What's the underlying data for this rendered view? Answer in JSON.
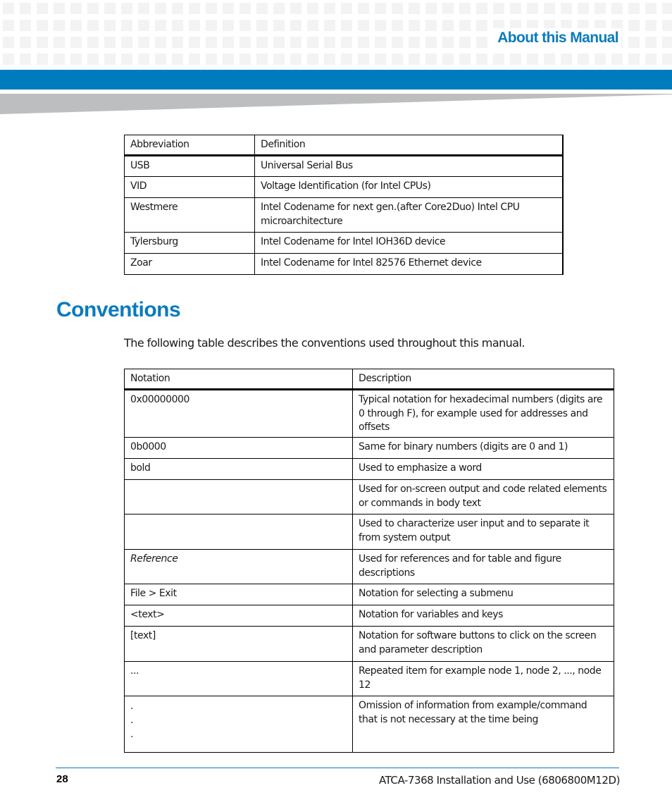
{
  "header": {
    "title": "About this Manual",
    "colors": {
      "accent_blue": "#007bbd",
      "title_blue": "#0a7bbd",
      "wedge_gray": "#bdbec0",
      "grid_gray": "#f3f3f3"
    }
  },
  "abbreviations_table": {
    "columns": [
      "Abbreviation",
      "Definition"
    ],
    "rows": [
      [
        "USB",
        "Universal Serial Bus"
      ],
      [
        "VID",
        "Voltage Identification (for Intel CPUs)"
      ],
      [
        "Westmere",
        "Intel Codename for next gen.(after Core2Duo) Intel CPU microarchitecture"
      ],
      [
        "Tylersburg",
        "Intel Codename for Intel IOH36D device"
      ],
      [
        "Zoar",
        "Intel Codename for Intel 82576 Ethernet device"
      ]
    ]
  },
  "conventions": {
    "title": "Conventions",
    "intro": "The following table describes the conventions used throughout this manual.",
    "columns": [
      "Notation",
      "Description"
    ],
    "rows": [
      [
        "0x00000000",
        "Typical notation for hexadecimal numbers (digits are 0 through F), for example used for addresses and offsets"
      ],
      [
        "0b0000",
        "Same for binary numbers (digits are 0 and 1)"
      ],
      [
        "bold",
        "Used to emphasize a word"
      ],
      [
        "",
        "Used for on-screen output and code related elements or commands in body text"
      ],
      [
        "",
        "Used to characterize user input and to separate it from system output"
      ],
      [
        "Reference",
        "Used for references and for table and figure descriptions"
      ],
      [
        "File > Exit",
        "Notation for selecting a submenu"
      ],
      [
        "<text>",
        "Notation for variables and keys"
      ],
      [
        "[text]",
        "Notation for software buttons to click on the screen and parameter description"
      ],
      [
        "...",
        "Repeated item for example node 1, node 2, ..., node 12"
      ],
      [
        ".",
        "Omission of information from example/command that is not necessary at the time being"
      ]
    ],
    "omission_dots": [
      ".",
      ".",
      "."
    ]
  },
  "footer": {
    "page_number": "28",
    "document": "ATCA-7368 Installation and Use (6806800M12D)"
  }
}
